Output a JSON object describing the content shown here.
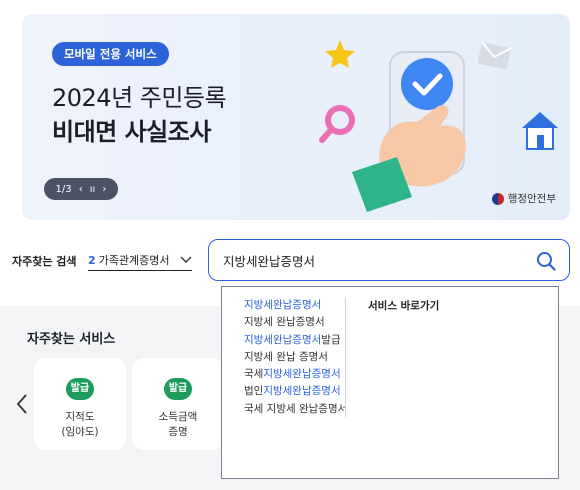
{
  "banner": {
    "badge": "모바일 전용 서비스",
    "title_line1": "2024년 주민등록",
    "title_line2": "비대면 사실조사",
    "pager": {
      "current": "1/3",
      "prev": "‹",
      "pause": "ıı",
      "next": "›"
    },
    "ministry": "행정안전부"
  },
  "search": {
    "frequent_label": "자주찾는 검색",
    "selected": {
      "rank": "2",
      "text": "가족관계증명서"
    },
    "query": "지방세완납증명서",
    "suggestions": [
      {
        "pre": "",
        "hl": "지방세완납증명서",
        "post": ""
      },
      {
        "pre": "지방세 완납증명서",
        "hl": "",
        "post": ""
      },
      {
        "pre": "",
        "hl": "지방세완납증명서",
        "post": "발급"
      },
      {
        "pre": "지방세 완납 증명서",
        "hl": "",
        "post": ""
      },
      {
        "pre": "국세",
        "hl": "지방세완납증명서",
        "post": ""
      },
      {
        "pre": "법인",
        "hl": "지방세완납증명서",
        "post": ""
      },
      {
        "pre": "국세 지방세 완납증명서",
        "hl": "",
        "post": ""
      }
    ],
    "shortcut_heading": "서비스 바로가기"
  },
  "services": {
    "title": "자주찾는 서비스",
    "cards": [
      {
        "badge": "발급",
        "name": "지적도\n(임야도)"
      },
      {
        "badge": "발급",
        "name": "소득금액\n증명"
      }
    ]
  },
  "colors": {
    "accent": "#2d63d8",
    "badge_green": "#1d9c5b"
  }
}
